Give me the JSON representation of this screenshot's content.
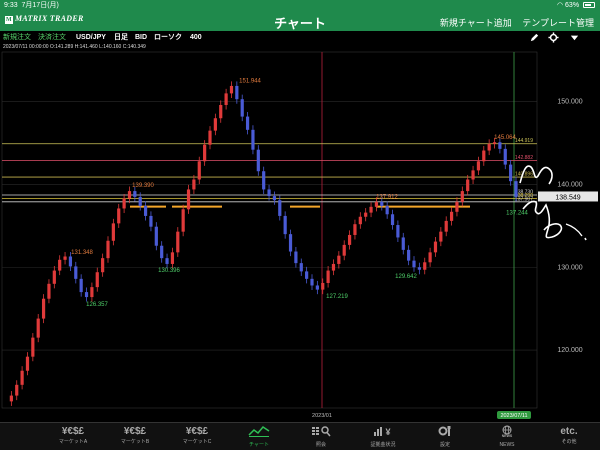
{
  "status_bar": {
    "time": "9:33",
    "date": "7月17日(月)",
    "battery": "63%"
  },
  "header": {
    "logo_text": "MATRIX TRADER",
    "title": "チャート",
    "new_chart_label": "新規チャート追加",
    "template_label": "テンプレート管理"
  },
  "toolbar": {
    "new_order": "新規注文",
    "settle_order": "決済注文",
    "pair": "USD/JPY",
    "timeframe": "日足",
    "price_type": "BID",
    "chart_style": "ローソク",
    "count": "400",
    "icons": [
      "pencil-icon",
      "gear-icon",
      "collapse-icon"
    ]
  },
  "ohlc_info": "2023/07/11 00:00:00  O:141.289  H:141.460  L:140.160  C:140.349",
  "chart_data": {
    "type": "candlestick",
    "ylim": [
      113,
      156
    ],
    "y_ticks": [
      "150.000",
      "140.000",
      "130.000",
      "120.000"
    ],
    "x_tick_label": "2023/01",
    "current_date_label": "2023/07/11",
    "current_price": "138.549",
    "annotations": {
      "highs": [
        "151.944",
        "145.064",
        "139.390",
        "137.912",
        "131.348"
      ],
      "lows": [
        "126.357",
        "130.396",
        "127.219",
        "129.642",
        "137.244"
      ]
    },
    "hlines": [
      {
        "value": "144.919",
        "color": "#cfc65a"
      },
      {
        "value": "142.882",
        "color": "#e0506a"
      },
      {
        "value": "140.896",
        "color": "#c9b650"
      },
      {
        "value": "138.730",
        "color": "#d9d9d9"
      },
      {
        "value": "138.290",
        "color": "#d8c23a"
      },
      {
        "value": "137.907",
        "color": "#cfcfcf"
      }
    ],
    "series": [
      {
        "name": "",
        "values": [
          113.8,
          114.5,
          115.8,
          117.5,
          119.2,
          121.5,
          123.8,
          126.2,
          128.0,
          129.6,
          130.9,
          131.3,
          130.1,
          128.6,
          127.0,
          126.4,
          127.6,
          129.4,
          131.1,
          133.2,
          135.3,
          137.1,
          138.3,
          139.2,
          138.5,
          137.4,
          136.2,
          134.9,
          132.6,
          131.1,
          130.4,
          131.8,
          134.3,
          137.0,
          139.4,
          140.6,
          142.8,
          144.8,
          146.5,
          148.0,
          149.6,
          151.0,
          151.9,
          150.3,
          148.2,
          146.6,
          144.2,
          141.6,
          139.4,
          138.6,
          138.1,
          136.2,
          134.0,
          131.9,
          130.5,
          129.5,
          128.6,
          127.8,
          127.3,
          128.1,
          129.6,
          130.4,
          131.4,
          132.7,
          133.9,
          135.2,
          136.1,
          136.6,
          137.3,
          137.9,
          137.4,
          136.4,
          135.1,
          133.6,
          132.1,
          130.8,
          130.0,
          129.7,
          130.6,
          131.8,
          133.1,
          134.3,
          135.6,
          136.7,
          137.9,
          139.2,
          140.6,
          141.7,
          142.8,
          144.1,
          144.9,
          145.1,
          144.3,
          142.4,
          140.4,
          138.5
        ]
      }
    ]
  },
  "tabs": [
    {
      "glyph": "¥€$£",
      "label": "マーケットA",
      "icon": "currency-icon"
    },
    {
      "glyph": "¥€$£",
      "label": "マーケットB",
      "icon": "currency-icon"
    },
    {
      "glyph": "¥€$£",
      "label": "マーケットC",
      "icon": "currency-icon"
    },
    {
      "glyph": "",
      "label": "チャート",
      "icon": "chart-icon"
    },
    {
      "glyph": "",
      "label": "照会",
      "icon": "search-grid-icon"
    },
    {
      "glyph": "",
      "label": "証拠金状況",
      "icon": "margin-icon"
    },
    {
      "glyph": "",
      "label": "設定",
      "icon": "settings-icon"
    },
    {
      "glyph": "",
      "label": "NEWS",
      "icon": "news-icon"
    },
    {
      "glyph": "etc.",
      "label": "その他",
      "icon": "more-icon"
    }
  ]
}
